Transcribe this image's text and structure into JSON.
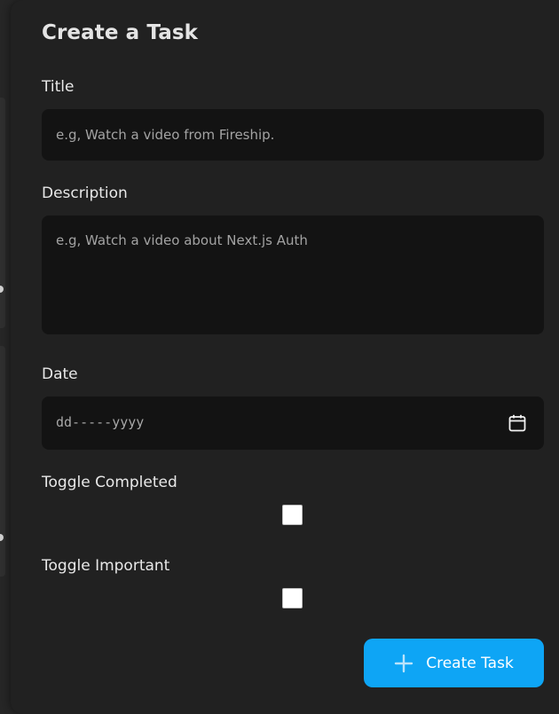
{
  "form": {
    "title": "Create a Task",
    "fields": {
      "title_label": "Title",
      "title_placeholder": "e.g, Watch a video from Fireship.",
      "description_label": "Description",
      "description_placeholder": "e.g, Watch a video about Next.js Auth",
      "date_label": "Date",
      "date_placeholder": "dd-----yyyy",
      "completed_label": "Toggle Completed",
      "completed_checked": false,
      "important_label": "Toggle Important",
      "important_checked": false
    },
    "submit_label": "Create Task"
  },
  "icons": {
    "calendar": "calendar-icon",
    "plus": "plus-icon"
  },
  "colors": {
    "accent": "#0ea5f5",
    "panel": "#212121",
    "input_bg": "#131313",
    "label_text": "#e8e8e8"
  }
}
